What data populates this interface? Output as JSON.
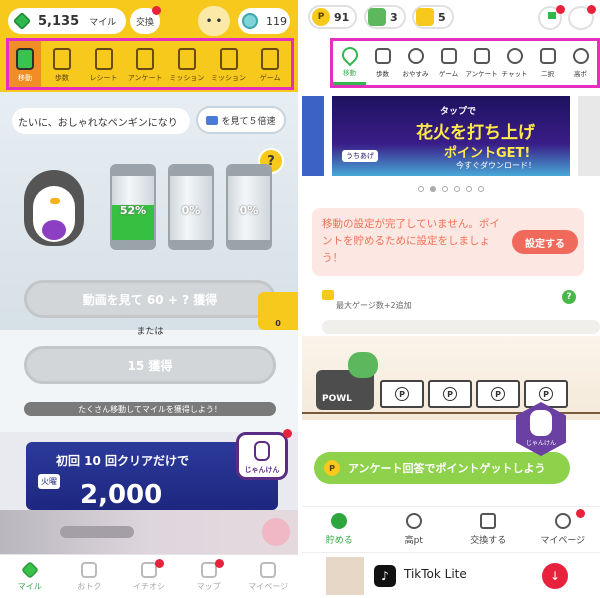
{
  "left": {
    "header": {
      "miles_value": "5,135",
      "miles_unit": "マイル",
      "exchange_label": "交換",
      "face_glyph": "• •",
      "coins": "119"
    },
    "tabs": [
      {
        "label": "移動",
        "icon": "battery-icon"
      },
      {
        "label": "歩数",
        "icon": "footprint-icon"
      },
      {
        "label": "レシート",
        "icon": "receipt-icon"
      },
      {
        "label": "アンケート",
        "icon": "survey-icon"
      },
      {
        "label": "ミッション",
        "icon": "gift-icon"
      },
      {
        "label": "ミッション",
        "icon": "gift-icon"
      },
      {
        "label": "ゲーム",
        "icon": "gamepad-icon"
      }
    ],
    "speech": "たいに、おしゃれなペンギンになり",
    "watch_btn": "を見て５倍速",
    "help_glyph": "?",
    "jars": [
      {
        "label": "52%",
        "fill": 0.52
      },
      {
        "label": "0%",
        "fill": 0
      },
      {
        "label": "0%",
        "fill": 0
      }
    ],
    "ad_watch_btn": "動画を見て  60 +  ?  獲得",
    "or_text": "または",
    "get15_btn": "15 獲得",
    "ticket_count": "0",
    "hint": "たくさん移動してマイルを獲得しよう！",
    "banner": {
      "line1": "初回 10 回クリアだけで",
      "tag": "火曜",
      "big": "2,000",
      "badge": "じゃんけん"
    },
    "nav": [
      {
        "label": "マイル",
        "icon": "gem-icon"
      },
      {
        "label": "おトク",
        "icon": "percent-icon"
      },
      {
        "label": "イチオシ",
        "icon": "thumbs-up-icon"
      },
      {
        "label": "マップ",
        "icon": "map-pin-icon"
      },
      {
        "label": "マイページ",
        "icon": "user-icon"
      }
    ]
  },
  "right": {
    "header": {
      "points": "91",
      "cards": "3",
      "tickets": "5"
    },
    "tabs": [
      {
        "label": "移動",
        "icon": "map-pin-icon"
      },
      {
        "label": "歩数",
        "icon": "footprint-icon"
      },
      {
        "label": "おやすみ",
        "icon": "sleep-icon"
      },
      {
        "label": "ゲーム",
        "icon": "gamepad-icon"
      },
      {
        "label": "アンケート",
        "icon": "survey-icon"
      },
      {
        "label": "チャット",
        "icon": "chat-icon"
      },
      {
        "label": "二択",
        "icon": "ab-icon"
      },
      {
        "label": "高ポ",
        "icon": "coin-icon"
      }
    ],
    "banner": {
      "line1": "タップで",
      "line2": "花火を打ち上げ",
      "line3": "ポイントGET!",
      "line4": "今すぐダウンロード！",
      "tag": "うちあげ"
    },
    "warning": {
      "text": "移動の設定が完了していません。ポイントを貯めるために設定をしましょう！",
      "button": "設定する"
    },
    "gauge_label": "最大ゲージ数+2追加",
    "help_glyph": "?",
    "engine_label": "POWL",
    "car_glyph": "P",
    "jk_label": "じゃんけん",
    "survey_btn": "アンケート回答でポイントゲットしよう",
    "nav": [
      {
        "label": "貯める",
        "icon": "piggy-icon"
      },
      {
        "label": "高pt",
        "icon": "pt-icon"
      },
      {
        "label": "交換する",
        "icon": "gift-icon"
      },
      {
        "label": "マイページ",
        "icon": "user-icon"
      }
    ],
    "ad": {
      "app_name": "TikTok Lite",
      "logo": "♪",
      "download_glyph": "↓"
    }
  }
}
